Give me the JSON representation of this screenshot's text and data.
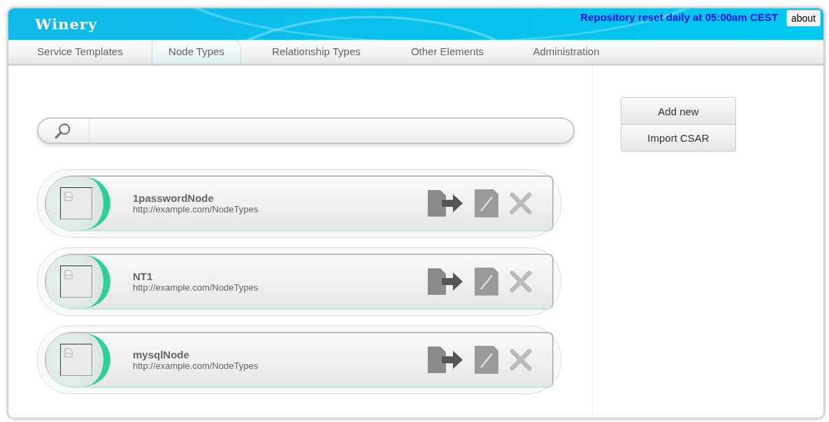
{
  "header": {
    "logo": "Winery",
    "notice": "Repository reset daily at 05:00am CEST",
    "about_button": "about"
  },
  "tabs": [
    {
      "label": "Service Templates",
      "selected": false
    },
    {
      "label": "Node Types",
      "selected": true
    },
    {
      "label": "Relationship Types",
      "selected": false
    },
    {
      "label": "Other Elements",
      "selected": false
    },
    {
      "label": "Administration",
      "selected": false
    }
  ],
  "items": [
    {
      "name": "1passwordNode",
      "namespace": "http://example.com/NodeTypes"
    },
    {
      "name": "NT1",
      "namespace": "http://example.com/NodeTypes"
    },
    {
      "name": "mysqlNode",
      "namespace": "http://example.com/NodeTypes"
    }
  ],
  "actions": [
    "Add new",
    "Import CSAR"
  ]
}
